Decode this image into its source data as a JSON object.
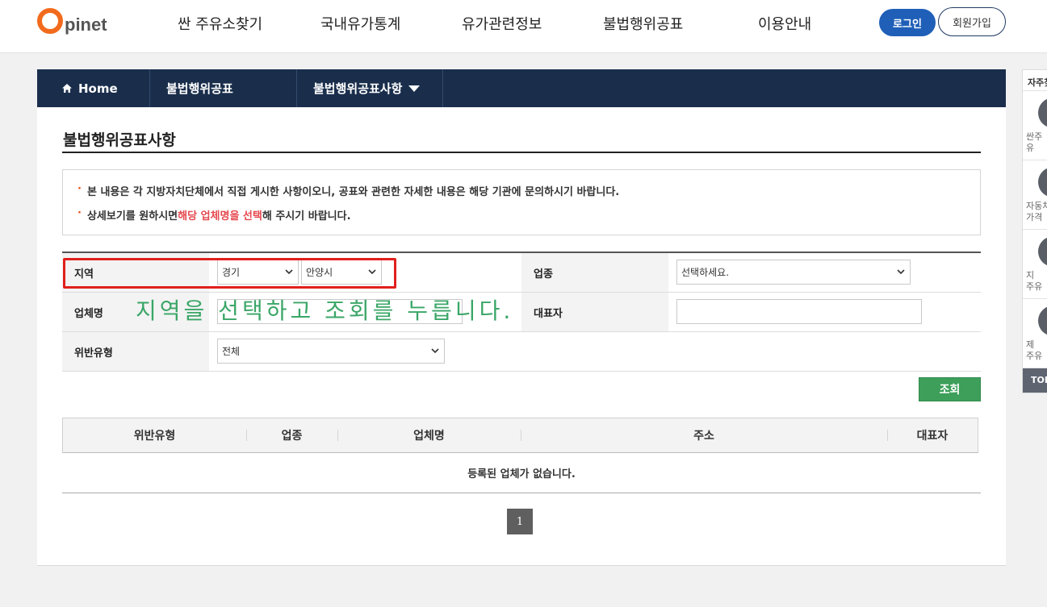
{
  "header": {
    "logo_text": "pinet",
    "nav": [
      "싼 주유소찾기",
      "국내유가통계",
      "유가관련정보",
      "불법행위공표",
      "이용안내"
    ],
    "login_label": "로그인",
    "join_label": "회원가입"
  },
  "breadcrumb": {
    "home": "Home",
    "level1": "불법행위공표",
    "level2": "불법행위공표사항"
  },
  "page": {
    "title": "불법행위공표사항",
    "notice_1": "본 내용은 각 지방자치단체에서 직접 게시한 사항이오니, 공표와 관련한 자세한 내용은 해당 기관에 문의하시기 바랍니다.",
    "notice_2_pre": "상세보기를 원하시면 ",
    "notice_2_highlight": "해당 업체명을 선택",
    "notice_2_post": "해 주시기 바랍니다."
  },
  "search": {
    "region_label": "지역",
    "region_province": "경기",
    "region_city": "안양시",
    "industry_label": "업종",
    "industry_value": "선택하세요.",
    "company_label": "업체명",
    "company_value": "",
    "rep_label": "대표자",
    "rep_value": "",
    "violation_label": "위반유형",
    "violation_value": "전체",
    "submit_label": "조회"
  },
  "annotation": {
    "text": "지역을 선택하고 조회를 누릅니다."
  },
  "results": {
    "columns": [
      "위반유형",
      "업종",
      "업체명",
      "주소",
      "대표자"
    ],
    "empty_message": "등록된 업체가 없습니다."
  },
  "pagination": {
    "current_page": "1"
  },
  "quick_menu": {
    "title": "자주찾는",
    "items": [
      {
        "label_1": "싼주",
        "label_2": "유"
      },
      {
        "label_1": "자동차",
        "label_2": "가격"
      },
      {
        "label_1": "지",
        "label_2": "주유"
      },
      {
        "label_1": "제",
        "label_2": "주유"
      }
    ],
    "top_label": "TOP"
  },
  "colors": {
    "brand_orange": "#f26b1d",
    "nav_dark": "#1a2e4c",
    "login_blue": "#1f5fb8",
    "search_green": "#3d9f5a",
    "annotation_green": "#3aa667",
    "highlight_red": "#e5484d"
  }
}
